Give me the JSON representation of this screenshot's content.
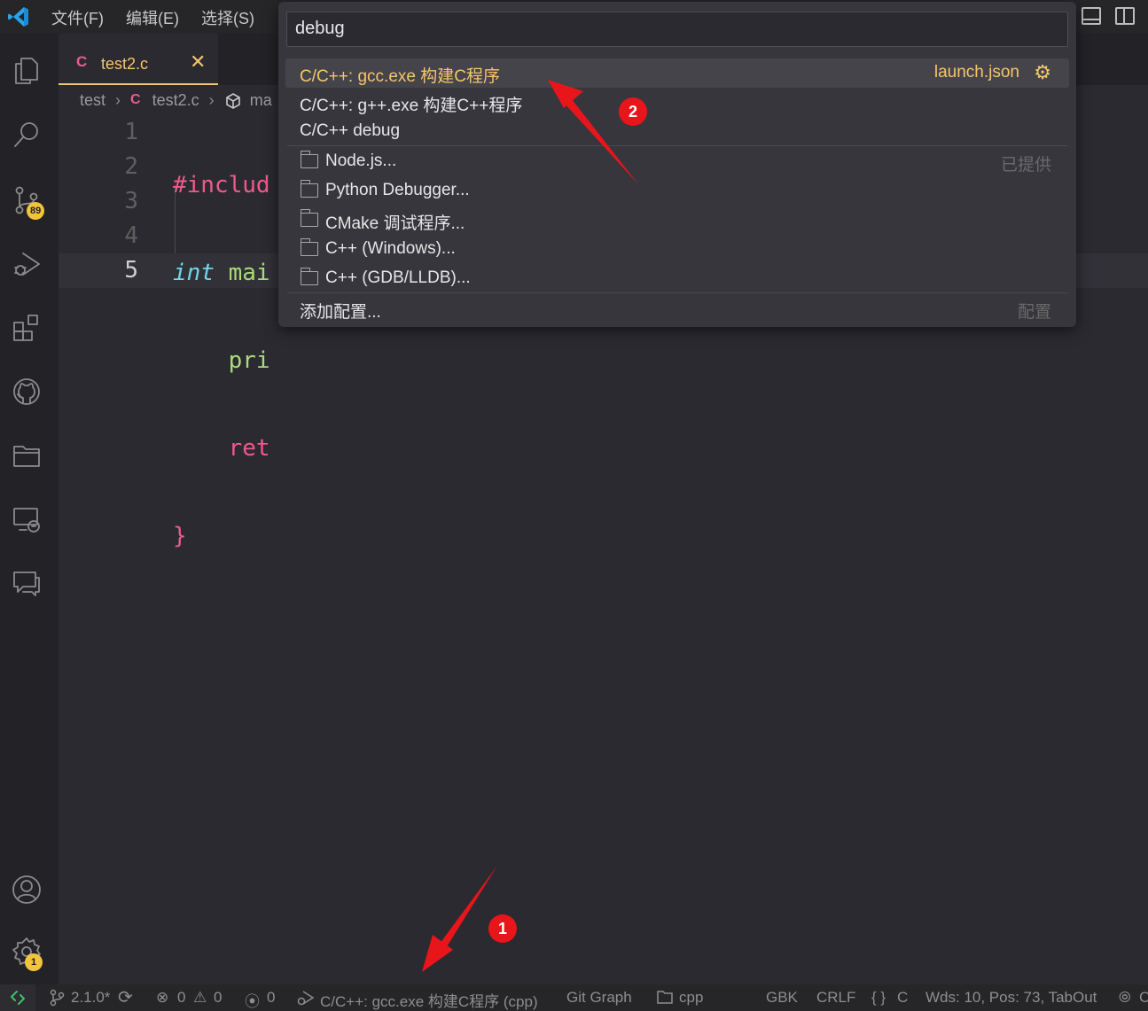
{
  "menu": [
    "文件(F)",
    "编辑(E)",
    "选择(S)"
  ],
  "activity": {
    "source_control_badge": "89",
    "settings_badge": "1"
  },
  "editor": {
    "tab": {
      "icon_letter": "C",
      "name": "test2.c",
      "close": "✕"
    },
    "breadcrumb": {
      "folder": "test",
      "icon_letter": "C",
      "file": "test2.c",
      "symbol": "ma"
    },
    "line_numbers": [
      "1",
      "2",
      "3",
      "4",
      "5"
    ],
    "code": {
      "l1": "#includ",
      "l2_type": "int",
      "l2_rest": " mai",
      "l3": "    pri",
      "l4": "    ret",
      "l5": "}"
    }
  },
  "quick_pick": {
    "input_value": "debug",
    "items": [
      {
        "label": "C/C++: gcc.exe 构建C程序",
        "description": "launch.json",
        "icon": "gear-icon"
      },
      {
        "label": "C/C++: g++.exe 构建C++程序"
      },
      {
        "label": "C/C++ debug"
      },
      {
        "label": "Node.js...",
        "description": "已提供",
        "icon": "folder-icon"
      },
      {
        "label": "Python Debugger...",
        "icon": "folder-icon"
      },
      {
        "label": "CMake 调试程序...",
        "icon": "folder-icon"
      },
      {
        "label": "C++ (Windows)...",
        "icon": "folder-icon"
      },
      {
        "label": "C++ (GDB/LLDB)...",
        "icon": "folder-icon"
      },
      {
        "label": "添加配置...",
        "description": "配置"
      }
    ]
  },
  "annotations": {
    "marker1": "1",
    "marker2": "2"
  },
  "status_bar": {
    "version": "2.1.0*",
    "errors": "0",
    "warnings": "0",
    "ports": "0",
    "launch_config": "C/C++: gcc.exe 构建C程序 (cpp)",
    "git_graph": "Git Graph",
    "folder": "cpp",
    "encoding": "GBK",
    "eol": "CRLF",
    "language": "C",
    "language_braces": "{ }",
    "word_info": "Wds: 10, Pos: 73, TabOut",
    "trailing": "C"
  },
  "colors": {
    "accent_yellow": "#f5c66a",
    "c_icon_pink": "#ef5a8a",
    "annotation_red": "#e8151b",
    "badge_yellow": "#f0c53c"
  }
}
